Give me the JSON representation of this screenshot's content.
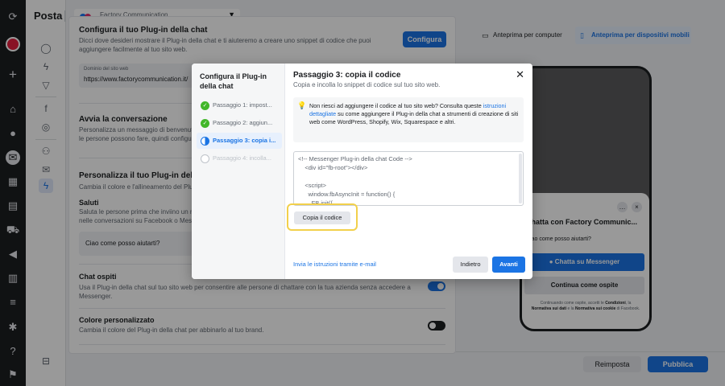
{
  "header": {
    "title": "Posta",
    "page_selector": "Factory Communication"
  },
  "settings": {
    "section1": {
      "title": "Configura il tuo Plug-in della chat",
      "desc1": "Dicci dove desideri mostrare il Plug-in della chat e ti aiuteremo a creare uno snippet di codice che puoi",
      "desc2": "aggiungere facilmente al tuo sito web.",
      "button": "Configura",
      "domain_label": "Dominio del sito web",
      "domain_value": "https://www.factorycommunication.it/"
    },
    "section2": {
      "title": "Avvia la conversazione",
      "desc1": "Personalizza un messaggio di benvenut",
      "desc2": "le persone possono fare, quindi configu"
    },
    "section3": {
      "title": "Personalizza il tuo Plug-in dell",
      "desc": "Cambia il colore e l'allineamento del Plu"
    },
    "greetings": {
      "title": "Saluti",
      "desc1": "Saluta le persone prima che inviino un m",
      "desc2": "nelle conversazioni su Facebook o Messe",
      "field_value": "Ciao come posso aiutarti?"
    },
    "guest_chat": {
      "title": "Chat ospiti",
      "desc1": "Usa il Plug-in della chat sul tuo sito web per consentire alle persone di chattare con la tua azienda senza accedere a",
      "desc2": "Messenger.",
      "enabled": true
    },
    "custom_color": {
      "title": "Colore personalizzato",
      "desc": "Cambia il colore del Plug-in della chat per abbinarlo al tuo brand.",
      "enabled": false
    }
  },
  "preview": {
    "tab_desktop": "Anteprima per computer",
    "tab_mobile": "Anteprima per dispositivi mobili",
    "chat_title": "Chatta con Factory Communic...",
    "chat_message": "Ciao come posso aiutarti?",
    "btn_messenger": "Chatta su Messenger",
    "btn_guest": "Continua come ospite",
    "footer_pre": "Continuando come ospite, accetti le",
    "footer_link1": "Condizioni",
    "footer_mid1": ", la",
    "footer_link2": "Normativa sui dati",
    "footer_mid2": "e la",
    "footer_link3": "Normativa sui cookie",
    "footer_post": "di Facebook."
  },
  "footer": {
    "reset": "Reimposta",
    "publish": "Pubblica"
  },
  "modal": {
    "left_title": "Configura il Plug-in della chat",
    "steps": [
      {
        "label": "Passaggio 1: impost...",
        "state": "done"
      },
      {
        "label": "Passaggio 2: aggiun...",
        "state": "done"
      },
      {
        "label": "Passaggio 3: copia i...",
        "state": "current"
      },
      {
        "label": "Passaggio 4: incolla...",
        "state": "pending"
      }
    ],
    "title": "Passaggio 3: copia il codice",
    "subtitle": "Copia e incolla lo snippet di codice sul tuo sito web.",
    "info_pre": "Non riesci ad aggiungere il codice al tuo sito web? Consulta queste",
    "info_link": "istruzioni dettagliate",
    "info_post": "su come aggiungere il Plug-in della chat a strumenti di creazione di siti web come WordPress, Shopify, Wix, Squarespace e altri.",
    "code": "<!-- Messenger Plug-in della chat Code -->\n    <div id=\"fb-root\"></div>\n\n    <script>\n      window.fbAsyncInit = function() {\n        FB.init({\n          xfbml : true,",
    "copy_button": "Copia il codice",
    "email_link": "Invia le istruzioni tramite e-mail",
    "back_button": "Indietro",
    "next_button": "Avanti"
  },
  "colors": {
    "accent": "#1b74e4",
    "highlight": "#f2d04b",
    "success": "#42b72a"
  }
}
